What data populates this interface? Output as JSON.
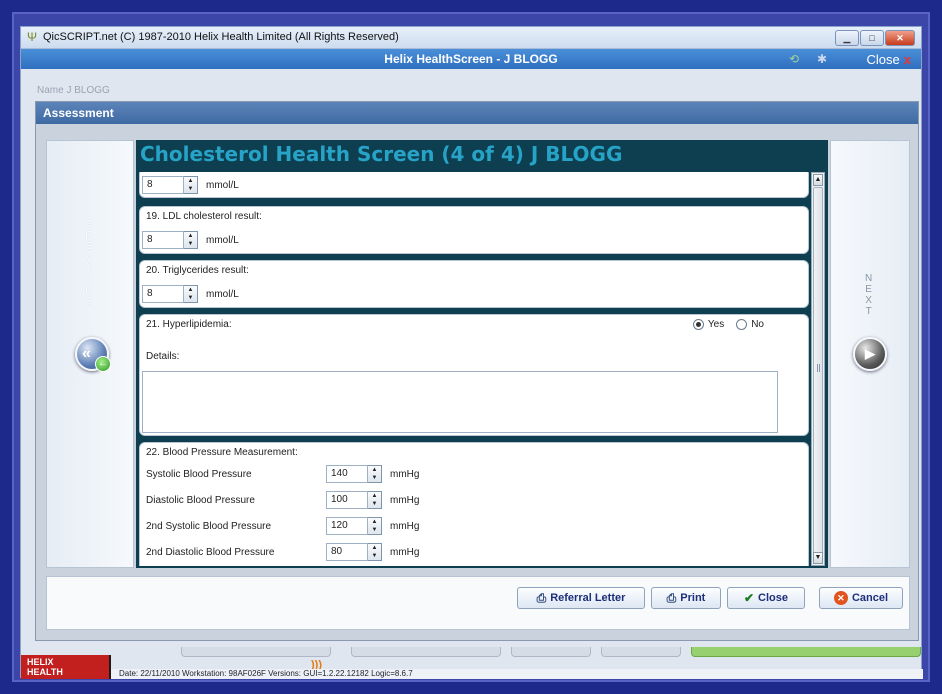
{
  "window": {
    "title": "QicSCRIPT.net (C) 1987-2010 Helix Health Limited (All Rights Reserved)",
    "controls": [
      "minimize",
      "maximize",
      "close"
    ]
  },
  "app_header": {
    "title": "Helix HealthScreen - J BLOGG",
    "close_label": "Close",
    "close_x": "x"
  },
  "background": {
    "name_label": "Name   J BLOGG"
  },
  "dialog": {
    "title": "Assessment",
    "prev_letters": [
      "P",
      "R",
      "E",
      "V",
      "I",
      "O",
      "U",
      "S"
    ],
    "next_letters": [
      "N",
      "E",
      "X",
      "T"
    ]
  },
  "form": {
    "heading": "Cholesterol Health Screen (4 of 4) J BLOGG",
    "q18": {
      "value": "8",
      "unit": "mmol/L"
    },
    "q19": {
      "label": "19. LDL cholesterol result:",
      "value": "8",
      "unit": "mmol/L"
    },
    "q20": {
      "label": "20. Triglycerides result:",
      "value": "8",
      "unit": "mmol/L"
    },
    "q21": {
      "label": "21. Hyperlipidemia:",
      "yes": "Yes",
      "no": "No",
      "selected": "Yes",
      "details_label": "Details:",
      "details_value": ""
    },
    "q22": {
      "label": "22. Blood Pressure Measurement:",
      "rows": [
        {
          "label": "Systolic Blood Pressure",
          "value": "140",
          "unit": "mmHg"
        },
        {
          "label": "Diastolic Blood Pressure",
          "value": "100",
          "unit": "mmHg"
        },
        {
          "label": "2nd Systolic Blood Pressure",
          "value": "120",
          "unit": "mmHg"
        },
        {
          "label": "2nd Diastolic Blood Pressure",
          "value": "80",
          "unit": "mmHg"
        }
      ]
    }
  },
  "buttons": {
    "referral": "Referral Letter",
    "print": "Print",
    "close": "Close",
    "cancel": "Cancel"
  },
  "logo": {
    "line1": "HELIX",
    "line2": "HEALTH"
  },
  "status_bar": {
    "text": "Date: 22/11/2010  Workstation: 98AF026F  Versions: GUI=1.2.22.12182  Logic=8.6.7"
  },
  "colors": {
    "heading": "#27a3c8",
    "form_panel": "#0d3f50",
    "app_header": "#2f6fc0",
    "logo": "#c21f1f"
  }
}
